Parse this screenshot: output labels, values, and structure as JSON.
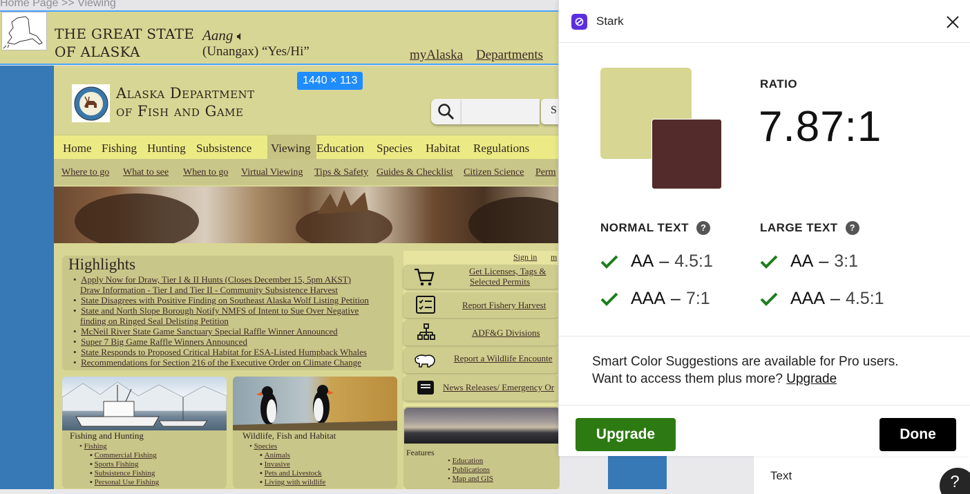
{
  "breadcrumb": "Home Page >> Viewing",
  "state": {
    "line1": "THE GREAT STATE",
    "line2": "OF ALASKA",
    "word": "Aang",
    "phrase": "(Unangax) “Yes/Hi”",
    "links": [
      "myAlaska",
      "Departments"
    ]
  },
  "dims_badge": "1440 × 113",
  "dept": {
    "name_line1": "Alaska Department",
    "name_line2": "of Fish and Game",
    "search_btn": "S"
  },
  "main_nav": [
    "Home",
    "Fishing",
    "Hunting",
    "Subsistence",
    "Viewing",
    "Education",
    "Species",
    "Habitat",
    "Regulations"
  ],
  "sub_nav": [
    "Where to go",
    "What to see",
    "When to go",
    "Virtual Viewing",
    "Tips & Safety",
    "Guides & Checklist",
    "Citizen Science",
    "Perm"
  ],
  "highlights": {
    "title": "Highlights",
    "items": [
      "Apply Now for Draw, Tier I & II Hunts (Closes December 15, 5pm AKST)",
      "Draw Information - Tier I and Tier II - Community Subsistence Harvest",
      "State Disagrees with Positive Finding on Southeast Alaska Wolf Listing Petition",
      "State and North Slope Borough Notify NMFS of Intent to Sue Over Negative",
      "finding on Ringed Seal Delisting Petition",
      "McNeil River State Game Sanctuary Special Raffle Winner Announced",
      "Super 7 Big Game Raffle Winners Announced",
      "State Responds to Proposed Critical Habitat for ESA-Listed Humpback Whales",
      "Recommendations for Section 216 of the Executive Order on Climate Change"
    ]
  },
  "signin": "Sign in",
  "signin_more": "m",
  "quick_links": [
    "Get Licenses, Tags &",
    "Selected Permits",
    "Report Fishery Harvest",
    "ADF&G Divisions",
    "Report a Wildlife Encounte",
    "News Releases/ Emergency Or"
  ],
  "fishing_card": {
    "title": "Fishing and Hunting",
    "top": "Fishing",
    "items": [
      "Commercial Fishing",
      "Sports Fishing",
      "Subsistence Fishing",
      "Personal Use Fishing"
    ]
  },
  "wildlife_card": {
    "title": "Wildlife, Fish and Habitat",
    "top": "Species",
    "items": [
      "Animals",
      "Invasive",
      "Pets and Livestock",
      "Living with wildlife"
    ]
  },
  "features": {
    "title": "Features",
    "items": [
      "Education",
      "Publications",
      "Map and GIS"
    ]
  },
  "stark": {
    "app_name": "Stark",
    "ratio_label": "RATIO",
    "ratio": "7.87:1",
    "fg_color": "#d7d693",
    "bg_color": "#532b2b",
    "normal_label": "NORMAL TEXT",
    "large_label": "LARGE TEXT",
    "normal": [
      {
        "level": "AA",
        "value": "4.5:1"
      },
      {
        "level": "AAA",
        "value": "7:1"
      }
    ],
    "large": [
      {
        "level": "AA",
        "value": "3:1"
      },
      {
        "level": "AAA",
        "value": "4.5:1"
      }
    ],
    "dash": "–",
    "promo_line1": "Smart Color Suggestions are available for Pro users.",
    "promo_line2": "Want to access them plus more?",
    "promo_link": "Upgrade",
    "upgrade_btn": "Upgrade",
    "done_btn": "Done"
  },
  "right_pane": {
    "label": "Text"
  },
  "help_glyph": "?",
  "colors": {
    "site_bg": "#d8d694",
    "side_blue": "#3778b6",
    "pass_green": "#1e7d1e",
    "upgrade_green": "#2d7a12"
  }
}
